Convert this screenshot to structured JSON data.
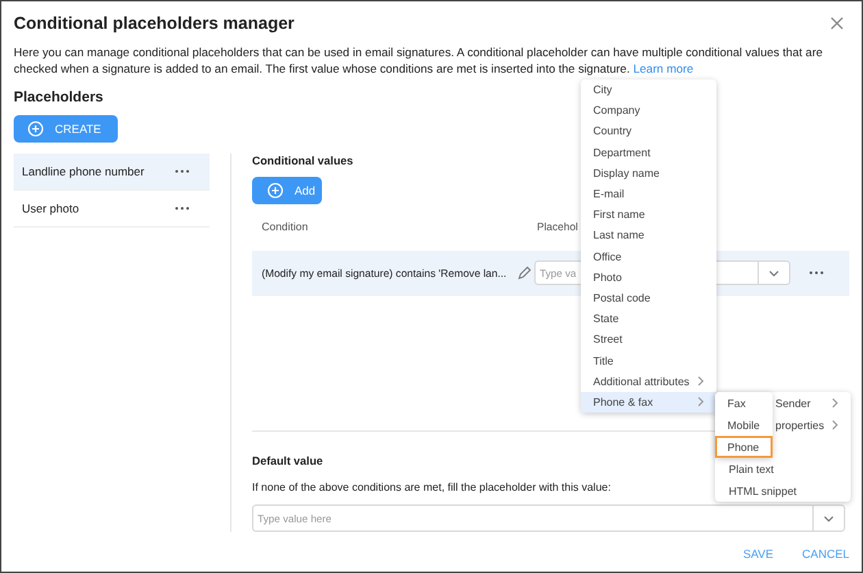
{
  "dialog": {
    "title": "Conditional placeholders manager",
    "description": "Here you can manage conditional placeholders that can be used in email signatures. A conditional placeholder can have multiple conditional values that are checked when a signature is added to an email. The first value whose conditions are met is inserted into the signature.",
    "learn_more": "Learn more"
  },
  "placeholders": {
    "heading": "Placeholders",
    "create_button": "CREATE",
    "items": [
      {
        "label": "Landline phone number",
        "selected": true
      },
      {
        "label": "User photo",
        "selected": false
      }
    ]
  },
  "conditional_values": {
    "heading": "Conditional values",
    "add_button": "Add",
    "columns": [
      "Condition",
      "Placehol"
    ],
    "rows": [
      {
        "condition": "(Modify my email signature) contains 'Remove lan...",
        "placeholder": "Type va"
      }
    ]
  },
  "default_value": {
    "heading": "Default value",
    "hint": "If none of the above conditions are met, fill the placeholder with this value:",
    "placeholder": "Type value here"
  },
  "footer_buttons": [
    "SAVE",
    "CANCEL"
  ],
  "menus": [
    {
      "items": [
        {
          "label": "City",
          "submenu": false,
          "highlighted": false
        },
        {
          "label": "Company",
          "submenu": false,
          "highlighted": false
        },
        {
          "label": "Country",
          "submenu": false,
          "highlighted": false
        },
        {
          "label": "Department",
          "submenu": false,
          "highlighted": false
        },
        {
          "label": "Display name",
          "submenu": false,
          "highlighted": false
        },
        {
          "label": "E-mail",
          "submenu": false,
          "highlighted": false
        },
        {
          "label": "First name",
          "submenu": false,
          "highlighted": false
        },
        {
          "label": "Last name",
          "submenu": false,
          "highlighted": false
        },
        {
          "label": "Office",
          "submenu": false,
          "highlighted": false
        },
        {
          "label": "Photo",
          "submenu": false,
          "highlighted": false
        },
        {
          "label": "Postal code",
          "submenu": false,
          "highlighted": false
        },
        {
          "label": "State",
          "submenu": false,
          "highlighted": false
        },
        {
          "label": "Street",
          "submenu": false,
          "highlighted": false
        },
        {
          "label": "Title",
          "submenu": false,
          "highlighted": false
        },
        {
          "label": "Additional attributes",
          "submenu": true,
          "highlighted": false
        },
        {
          "label": "Phone & fax",
          "submenu": true,
          "highlighted": true
        }
      ]
    },
    {
      "items": [
        {
          "label": "Sender",
          "submenu": true,
          "covered": true
        },
        {
          "label": "properties",
          "submenu": true,
          "covered": true
        },
        {
          "label": "Plain text",
          "submenu": false,
          "covered": false
        },
        {
          "label": "HTML snippet",
          "submenu": false,
          "covered": false
        }
      ]
    },
    {
      "items": [
        {
          "label": "Fax",
          "focused": false
        },
        {
          "label": "Mobile",
          "focused": false
        },
        {
          "label": "Phone",
          "focused": true
        }
      ]
    }
  ]
}
